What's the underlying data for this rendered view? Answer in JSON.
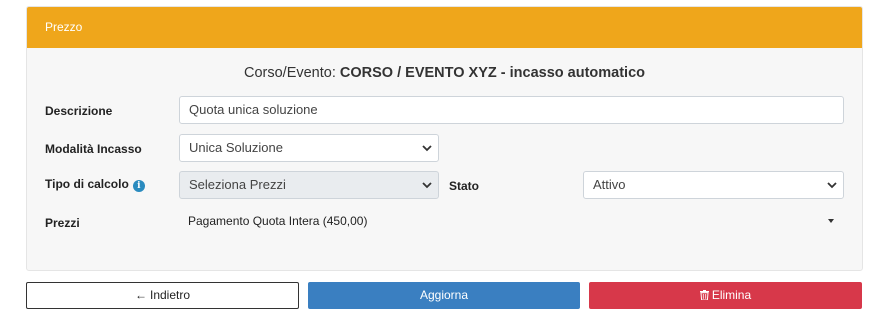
{
  "panel": {
    "title": "Prezzo",
    "subtitle_prefix": "Corso/Evento: ",
    "subtitle_course": "CORSO / EVENTO XYZ - incasso automatico"
  },
  "form": {
    "descrizione": {
      "label": "Descrizione",
      "value": "Quota unica soluzione"
    },
    "modalita_incasso": {
      "label": "Modalità Incasso",
      "value": "Unica Soluzione"
    },
    "tipo_calcolo": {
      "label": "Tipo di calcolo",
      "value": "Seleziona Prezzi",
      "info_icon": "info-icon"
    },
    "stato": {
      "label": "Stato",
      "value": "Attivo"
    },
    "prezzi": {
      "label": "Prezzi",
      "value": "Pagamento Quota Intera (450,00)"
    }
  },
  "buttons": {
    "back": {
      "label": "Indietro",
      "icon": "arrow-left-icon"
    },
    "update": {
      "label": "Aggiorna"
    },
    "delete": {
      "label": "Elimina",
      "icon": "trash-icon"
    }
  },
  "colors": {
    "header": "#efa61b",
    "update": "#3a7fc1",
    "delete": "#d7384a"
  }
}
